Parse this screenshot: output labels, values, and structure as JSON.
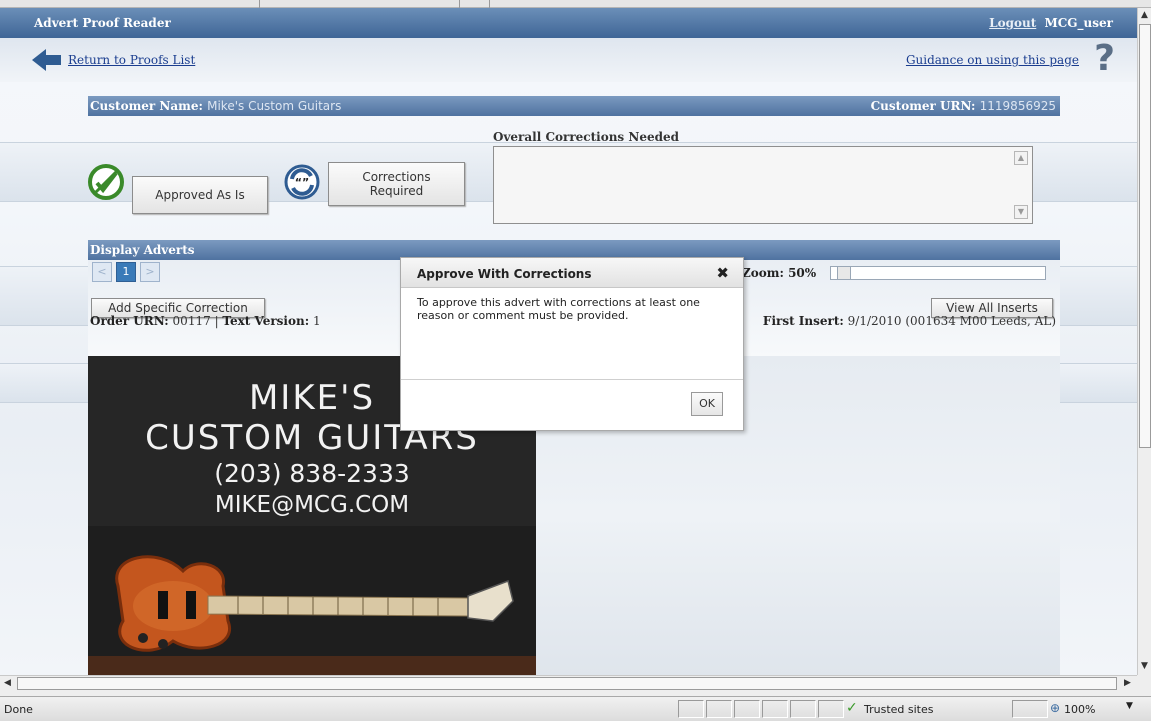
{
  "app": {
    "title": "Advert Proof Reader",
    "logout_label": "Logout",
    "username": "MCG_user"
  },
  "nav": {
    "return_link": "Return to Proofs List",
    "guidance_link": "Guidance on using this page",
    "help_icon": "?"
  },
  "customer": {
    "name_label": "Customer Name:",
    "name_value": "Mike's Custom Guitars",
    "urn_label": "Customer URN:",
    "urn_value": "1119856925"
  },
  "actions": {
    "approved_label": "Approved As Is",
    "corrections_label": "Corrections Required",
    "overall_corrections_label": "Overall Corrections Needed",
    "overall_corrections_value": ""
  },
  "display_adverts": {
    "title": "Display Adverts",
    "prev_icon": "<",
    "page_number": "1",
    "next_icon": ">",
    "zoom_label": "Zoom: 50%",
    "zoom_level_percent": 50,
    "add_correction_label": "Add Specific Correction",
    "view_inserts_label": "View All Inserts",
    "order_urn_label": "Order URN:",
    "order_urn_value": "00117",
    "text_version_label": "Text Version:",
    "text_version_value": "1",
    "first_insert_label": "First Insert:",
    "first_insert_value": "9/1/2010 (001634 M00 Leeds, AL)"
  },
  "advert": {
    "line1": "MIKE'S",
    "line2": "CUSTOM GUITARS",
    "line3": "(203) 838-2333",
    "line4": "MIKE@MCG.COM"
  },
  "modal": {
    "title": "Approve With Corrections",
    "close_icon": "✖",
    "message": "To approve this advert with corrections at least one reason or comment must be provided.",
    "ok_label": "OK"
  },
  "statusbar": {
    "status": "Done",
    "zone": "Trusted sites",
    "zoom": "100%"
  },
  "colors": {
    "header_blue": "#4f72a0",
    "link_blue": "#1a3d8f",
    "approved_green": "#3a8a2a",
    "pager_active": "#3a7ab8"
  }
}
